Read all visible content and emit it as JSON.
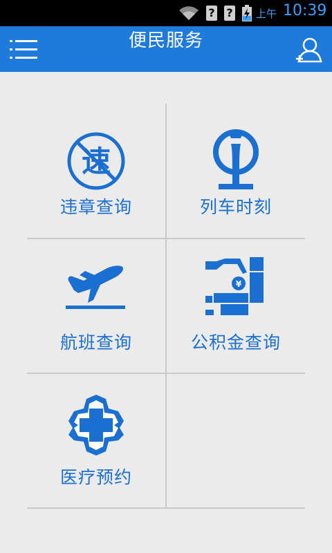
{
  "status_bar": {
    "ampm": "上午",
    "time": "10:39",
    "unknown_glyph": "?"
  },
  "app_bar": {
    "title": "便民服务"
  },
  "grid_items": [
    {
      "label": "违章查询",
      "icon": "violation-icon"
    },
    {
      "label": "列车时刻",
      "icon": "train-icon"
    },
    {
      "label": "航班查询",
      "icon": "plane-icon"
    },
    {
      "label": "公积金查询",
      "icon": "housing-fund-icon"
    },
    {
      "label": "医疗预约",
      "icon": "medical-icon"
    }
  ],
  "colors": {
    "accent": "#1e7bdb",
    "icon_blue": "#1a6fd0",
    "background": "#ebebeb"
  }
}
